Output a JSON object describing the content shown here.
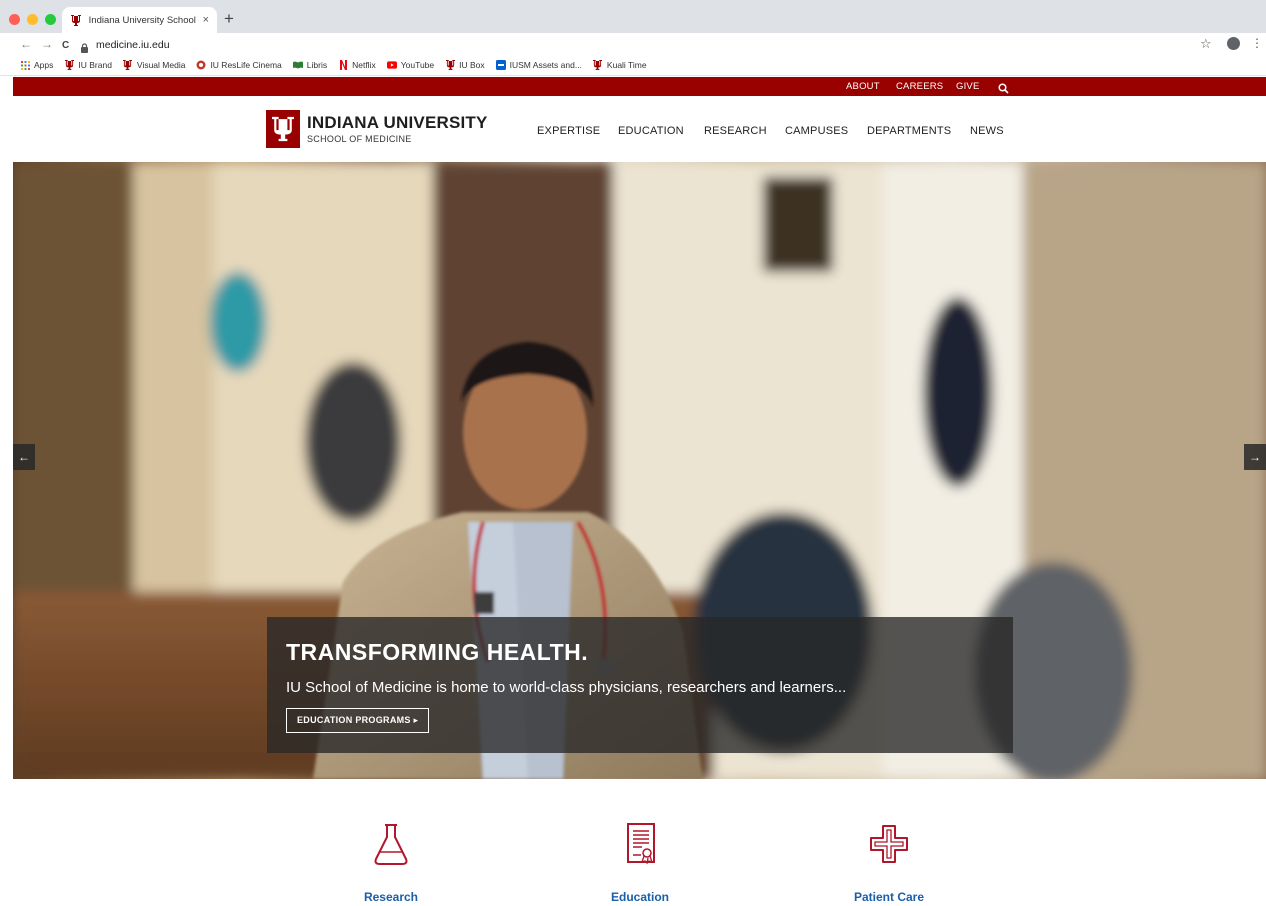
{
  "browser": {
    "tab_title": "Indiana University School of M",
    "tab_close": "×",
    "new_tab": "+",
    "back": "←",
    "forward": "→",
    "reload": "C",
    "url": "medicine.iu.edu",
    "star": "☆",
    "menu": "⋮"
  },
  "bookmarks": [
    {
      "label": "Apps",
      "icon": "apps-grid-icon"
    },
    {
      "label": "IU Brand",
      "icon": "iu-trident-icon"
    },
    {
      "label": "Visual Media",
      "icon": "iu-trident-icon"
    },
    {
      "label": "IU ResLife Cinema",
      "icon": "reslife-icon"
    },
    {
      "label": "Libris",
      "icon": "libris-icon"
    },
    {
      "label": "Netflix",
      "icon": "netflix-icon"
    },
    {
      "label": "YouTube",
      "icon": "youtube-icon"
    },
    {
      "label": "IU Box",
      "icon": "iu-trident-icon"
    },
    {
      "label": "IUSM Assets and...",
      "icon": "box-icon"
    },
    {
      "label": "Kuali Time",
      "icon": "iu-trident-icon"
    }
  ],
  "utility_nav": {
    "about": "ABOUT",
    "careers": "CAREERS",
    "give": "GIVE"
  },
  "brand": {
    "name": "INDIANA UNIVERSITY",
    "sub": "SCHOOL OF MEDICINE",
    "color": "#990000"
  },
  "main_nav": [
    "EXPERTISE",
    "EDUCATION",
    "RESEARCH",
    "CAMPUSES",
    "DEPARTMENTS",
    "NEWS"
  ],
  "hero": {
    "title": "TRANSFORMING HEALTH.",
    "text": "IU School of Medicine is home to world-class physicians, researchers and learners...",
    "button": "EDUCATION PROGRAMS ▸",
    "prev": "←",
    "next": "→"
  },
  "features": [
    {
      "label": "Research",
      "icon": "flask-icon"
    },
    {
      "label": "Education",
      "icon": "diploma-icon"
    },
    {
      "label": "Patient Care",
      "icon": "medical-cross-icon"
    }
  ],
  "colors": {
    "iu_crimson": "#990000",
    "link_blue": "#1a5fa8"
  }
}
